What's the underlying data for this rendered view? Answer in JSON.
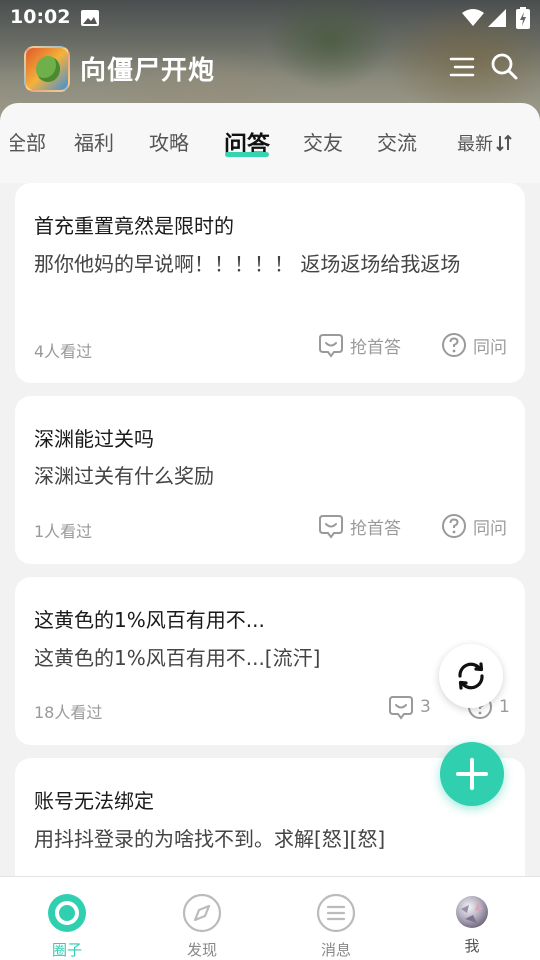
{
  "status_bar": {
    "time": "10:02",
    "icons": [
      "image-icon",
      "wifi-icon",
      "signal-icon",
      "battery-icon"
    ]
  },
  "header": {
    "app_title": "向僵尸开炮",
    "icons": [
      "app-icon",
      "menu-icon",
      "search-icon"
    ]
  },
  "tabs": {
    "items": [
      "全部",
      "福利",
      "攻略",
      "问答",
      "交友",
      "交流"
    ],
    "active_index": 3,
    "sort_label": "最新"
  },
  "posts": [
    {
      "title": "首充重置竟然是限时的",
      "body": "那你他妈的早说啊！！！！！ 返场返场给我返场",
      "views": "4人看过",
      "answer_label": "抢首答",
      "ask_label": "同问"
    },
    {
      "title": "深渊能过关吗",
      "body": "深渊过关有什么奖励",
      "views": "1人看过",
      "answer_label": "抢首答",
      "ask_label": "同问"
    },
    {
      "title": "这黄色的1%风百有用不...",
      "body": "这黄色的1%风百有用不...[流汗]",
      "views": "18人看过",
      "answer_count": "3",
      "ask_count": "1"
    },
    {
      "title": "账号无法绑定",
      "body": "用抖抖登录的为啥找不到。求解[怒][怒]"
    }
  ],
  "bottom_nav": {
    "items": [
      {
        "label": "圈子",
        "icon": "circle-icon",
        "active": true
      },
      {
        "label": "发现",
        "icon": "compass-icon",
        "active": false
      },
      {
        "label": "消息",
        "icon": "message-icon",
        "active": false
      },
      {
        "label": "我",
        "icon": "avatar-icon",
        "active": false
      }
    ]
  },
  "colors": {
    "accent": "#2fcfb0",
    "text": "#1a1a1a",
    "muted": "#9a9a9a",
    "background": "#f2f2f2"
  }
}
